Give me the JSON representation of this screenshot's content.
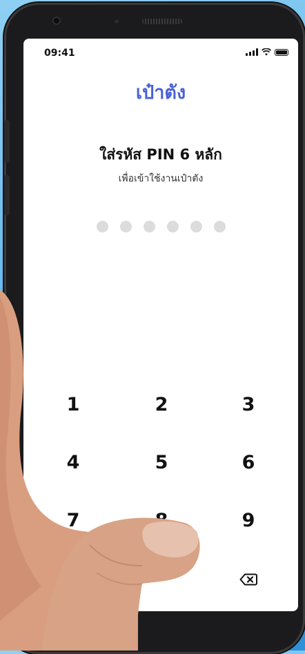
{
  "status_bar": {
    "time": "09:41"
  },
  "app": {
    "title": "เป๋าตัง"
  },
  "pin_screen": {
    "heading": "ใส่รหัส PIN 6 หลัก",
    "subtitle": "เพื่อเข้าใช้งานเป๋าตัง",
    "pin_length": 6,
    "entered_digits": 0
  },
  "keypad": {
    "keys": [
      "1",
      "2",
      "3",
      "4",
      "5",
      "6",
      "7",
      "8",
      "9"
    ],
    "backspace_icon": "backspace-icon"
  },
  "colors": {
    "brand": "#4a62d6",
    "pin_dot_empty": "#dcdcdc",
    "background": "#5fb6ec"
  }
}
